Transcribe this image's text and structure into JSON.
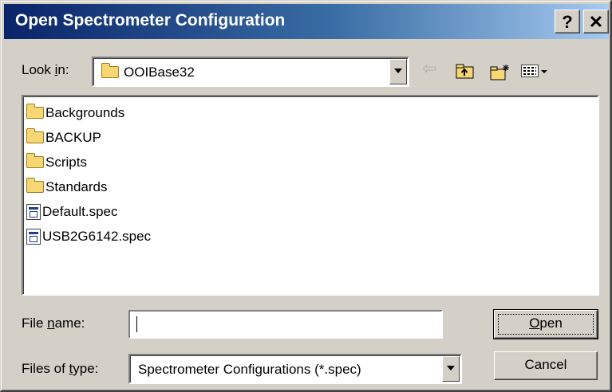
{
  "window": {
    "title": "Open Spectrometer Configuration",
    "help_label": "?",
    "close_label": "✕"
  },
  "lookin": {
    "label_prefix": "Look ",
    "label_accel": "i",
    "label_suffix": "n:",
    "value": "OOIBase32"
  },
  "toolbar": {
    "back_icon": "back-arrow-icon",
    "up_icon": "up-one-level-icon",
    "new_folder_icon": "new-folder-icon",
    "view_menu_icon": "view-menu-icon"
  },
  "files": [
    {
      "name": "Backgrounds",
      "type": "folder"
    },
    {
      "name": "BACKUP",
      "type": "folder"
    },
    {
      "name": "Scripts",
      "type": "folder"
    },
    {
      "name": "Standards",
      "type": "folder"
    },
    {
      "name": "Default.spec",
      "type": "spec"
    },
    {
      "name": "USB2G6142.spec",
      "type": "spec"
    }
  ],
  "filename": {
    "label_prefix": "File ",
    "label_accel": "n",
    "label_suffix": "ame:",
    "value": ""
  },
  "filetype": {
    "label_prefix": "Files of ",
    "label_accel": "t",
    "label_suffix": "ype:",
    "value": "Spectrometer Configurations (*.spec)"
  },
  "buttons": {
    "open_accel": "O",
    "open_rest": "pen",
    "cancel": "Cancel"
  },
  "colors": {
    "title_gradient_start": "#0a246a",
    "title_gradient_end": "#a6caf0",
    "face": "#d4d0c8"
  }
}
